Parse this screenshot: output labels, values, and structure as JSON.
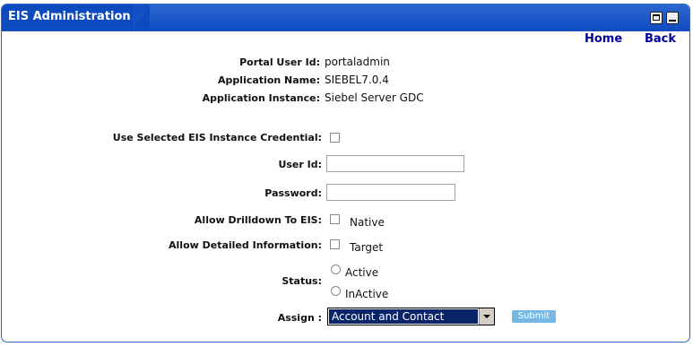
{
  "window": {
    "title": "EIS Administration"
  },
  "nav": {
    "home": "Home",
    "back": "Back"
  },
  "info": {
    "portal_user_label": "Portal User Id:",
    "portal_user_value": "portaladmin",
    "app_name_label": "Application Name:",
    "app_name_value": "SIEBEL7.0.4",
    "app_instance_label": "Application Instance:",
    "app_instance_value": "Siebel Server GDC"
  },
  "form": {
    "use_credential_label": "Use Selected EIS Instance Credential:",
    "user_id_label": "User Id:",
    "user_id_value": "",
    "password_label": "Password:",
    "password_value": "",
    "drilldown_label": "Allow Drilldown To EIS:",
    "drilldown_option": "Native",
    "detailed_label": "Allow Detailed Information:",
    "detailed_option": "Target",
    "status_label": "Status:",
    "status_options": [
      "Active",
      "InActive"
    ],
    "assign_label": "Assign :",
    "assign_value": "Account and Contact",
    "submit_label": "Submit"
  }
}
